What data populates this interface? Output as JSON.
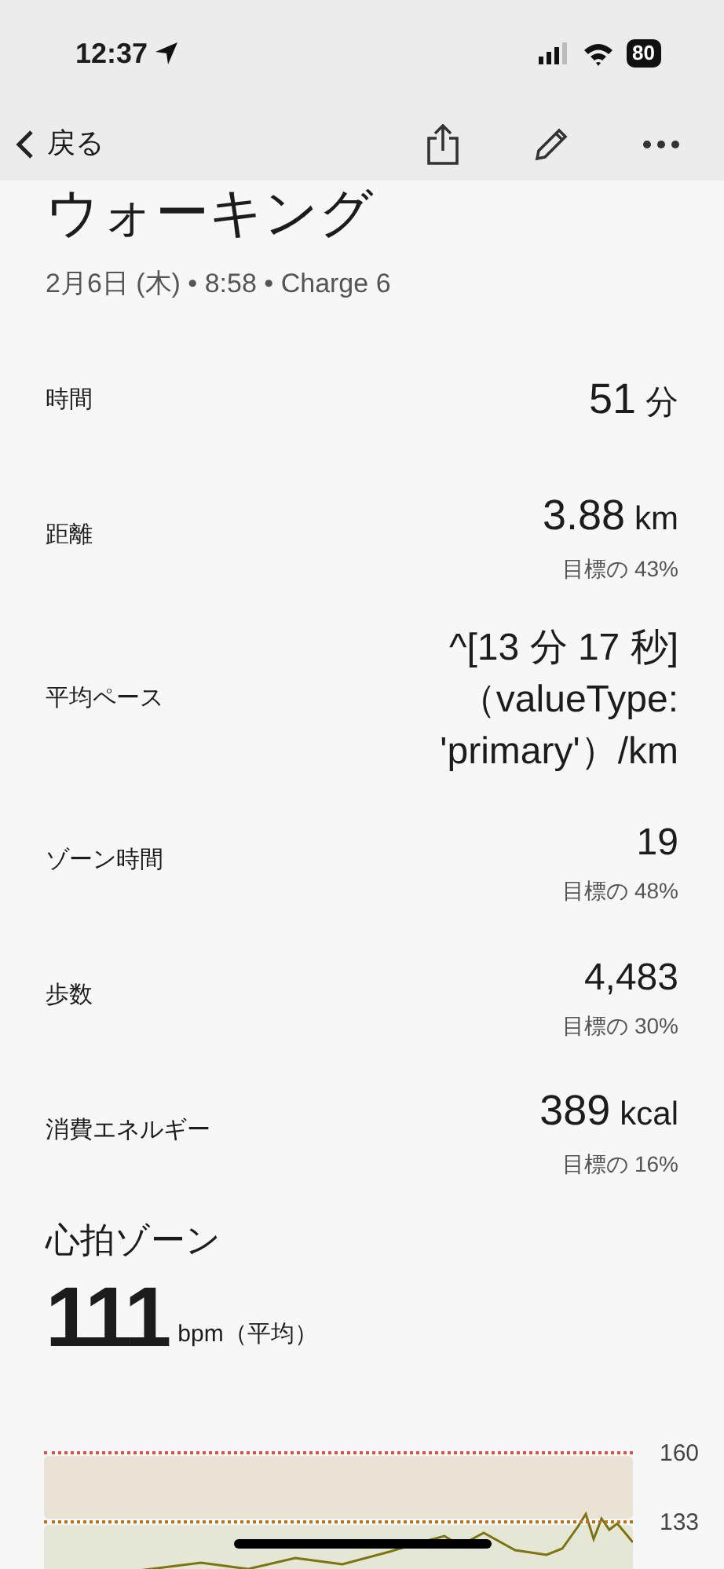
{
  "status_bar": {
    "time": "12:37",
    "battery": "80"
  },
  "nav": {
    "back": "戻る"
  },
  "title": "ウォーキング",
  "subtitle": "2月6日 (木) • 8:58 • Charge 6",
  "stats": [
    {
      "label": "時間",
      "value": "51",
      "unit": "分"
    },
    {
      "label": "距離",
      "value": "3.88",
      "unit": "km",
      "goal": "目標の 43%"
    },
    {
      "label": "平均ペース",
      "value": "^[13 分 17 秒]（valueType: 'primary'）/km"
    },
    {
      "label": "ゾーン時間",
      "value": "19",
      "goal": "目標の 48%"
    },
    {
      "label": "歩数",
      "value": "4,483",
      "goal": "目標の 30%"
    },
    {
      "label": "消費エネルギー",
      "value": "389",
      "unit": "kcal",
      "goal": "目標の 16%"
    }
  ],
  "heart": {
    "title": "心拍ゾーン",
    "value": "111",
    "unit": "bpm（平均）",
    "thresholds": [
      {
        "label": "160",
        "color": "#d9534f"
      },
      {
        "label": "133",
        "color": "#b8741a"
      }
    ]
  }
}
